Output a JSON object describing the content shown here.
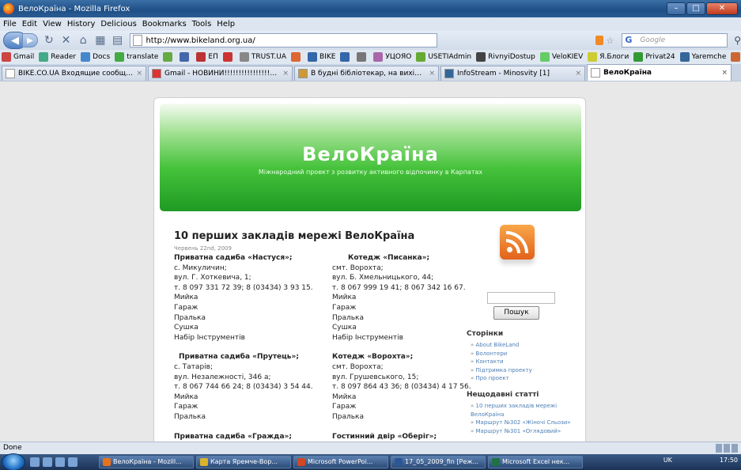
{
  "window": {
    "title": "ВелоКраїна - Mozilla Firefox",
    "min": "–",
    "max": "□",
    "close": "✕"
  },
  "menu": [
    "File",
    "Edit",
    "View",
    "History",
    "Delicious",
    "Bookmarks",
    "Tools",
    "Help"
  ],
  "nav": {
    "url": "http://www.bikeland.org.ua/",
    "search_placeholder": "Google"
  },
  "bookmarks": [
    {
      "label": "Gmail",
      "color": "#c44"
    },
    {
      "label": "Reader",
      "color": "#4a8"
    },
    {
      "label": "Docs",
      "color": "#48c"
    },
    {
      "label": "translate",
      "color": "#4a4"
    },
    {
      "label": "",
      "color": "#6a4"
    },
    {
      "label": "",
      "color": "#46a"
    },
    {
      "label": "ЕП",
      "color": "#b33"
    },
    {
      "label": "",
      "color": "#c33"
    },
    {
      "label": "TRUST.UA",
      "color": "#888"
    },
    {
      "label": "",
      "color": "#d63"
    },
    {
      "label": "BIKE",
      "color": "#36a"
    },
    {
      "label": "",
      "color": "#36a"
    },
    {
      "label": "",
      "color": "#777"
    },
    {
      "label": "УЦОЯО",
      "color": "#a6a"
    },
    {
      "label": "USETIAdmin",
      "color": "#6a3"
    },
    {
      "label": "RivnyiDostup",
      "color": "#444"
    },
    {
      "label": "VeloKIEV",
      "color": "#6c6"
    },
    {
      "label": "Я.Блоги",
      "color": "#cc3"
    },
    {
      "label": "Privat24",
      "color": "#393"
    },
    {
      "label": "Yaremche",
      "color": "#369"
    },
    {
      "label": "Клуб 25",
      "color": "#c63"
    },
    {
      "label": "НФЗ",
      "color": "#c33"
    }
  ],
  "tabs": [
    {
      "label": "BIKE.CO.UA Входящие сообщения",
      "color": "#fff",
      "active": false
    },
    {
      "label": "Gmail - НОВИНИ!!!!!!!!!!!!!!!!!!!!!!!!!!...",
      "color": "#d33",
      "active": false
    },
    {
      "label": "В будні бібліотекар, на вихідних ве...",
      "color": "#c93",
      "active": false
    },
    {
      "label": "InfoStream - Minosvity [1]",
      "color": "#369",
      "active": false
    },
    {
      "label": "ВелоКраїна",
      "color": "#fff",
      "active": true
    }
  ],
  "site": {
    "title": "ВелоКраїна",
    "tagline": "Міжнародний проект з розвитку активного відпочинку в Карпатах"
  },
  "post": {
    "title": "10 перших закладів мережі ВелоКраїна",
    "date": "Червень 22nd, 2009",
    "col1": [
      {
        "head": "Приватна садиба «Настуся»;",
        "lines": [
          "с. Микуличин;",
          "вул. Г. Хоткевича, 1;",
          "т. 8 097 331 72 39; 8 (03434) 3 93 15.",
          "Мийка",
          "Гараж",
          "Пралька",
          "Сушка",
          "Набір Інструментів"
        ]
      },
      {
        "head": "Приватна садиба «Прутець»;",
        "lines": [
          "с. Татарів;",
          "вул. Незалежності, 346 а;",
          "т. 8 067 744 66 24; 8 (03434) 3 54 44.",
          "Мийка",
          "Гараж",
          "Пралька"
        ]
      },
      {
        "head": "Приватна садиба «Гражда»;",
        "lines": []
      }
    ],
    "col2": [
      {
        "head": "Котедж «Писанка»;",
        "lines": [
          "смт. Ворохта;",
          "вул. Б. Хмельницького, 44;",
          "т. 8 067 999 19 41; 8 067 342 16 67.",
          "Мийка",
          "Гараж",
          "Пралька",
          "Сушка",
          "Набір Інструментів"
        ]
      },
      {
        "head": "Котедж «Ворохта»;",
        "lines": [
          "смт. Ворохта;",
          "вул. Грушевського, 15;",
          "т. 8 097 864 43 36; 8 (03434) 4 17 56.",
          "Мийка",
          "Гараж",
          "Пралька"
        ]
      },
      {
        "head": "Гостинний двір «Оберіг»;",
        "lines": []
      }
    ]
  },
  "sidebar": {
    "search_button": "Пошук",
    "pages_head": "Сторінки",
    "pages": [
      "About BikeLand",
      "Волонтери",
      "Контакти",
      "Підтримка проекту",
      "Про проект"
    ],
    "recent_head": "Нещодавні статті",
    "recent": [
      "10 перших закладів мережі ВелоКраїна",
      "Маршрут №302 «Жіночі Сльози»",
      "Маршрут №301 «Оглядовий»"
    ]
  },
  "status": {
    "text": "Done"
  },
  "taskbar": {
    "tasks": [
      {
        "label": "ВелоКраїна - Mozill...",
        "color": "#e8721c"
      },
      {
        "label": "Карта Яремче-Вор...",
        "color": "#d9b32a"
      },
      {
        "label": "Microsoft PowerPoi...",
        "color": "#d24726"
      },
      {
        "label": "17_05_2009_fin [Реж...",
        "color": "#2b5797"
      },
      {
        "label": "Microsoft Excel нек...",
        "color": "#207245"
      }
    ],
    "lang": "UK",
    "clock": "17:50"
  }
}
